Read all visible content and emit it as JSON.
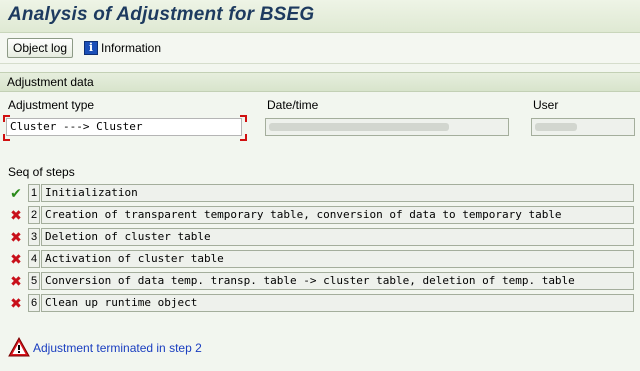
{
  "window": {
    "title": "Analysis of Adjustment for BSEG"
  },
  "toolbar": {
    "object_log_label": "Object log",
    "information_label": "Information"
  },
  "section": {
    "title": "Adjustment data"
  },
  "fields": {
    "adjustment_type": {
      "label": "Adjustment type",
      "value": "Cluster ---> Cluster"
    },
    "datetime": {
      "label": "Date/time",
      "value": ""
    },
    "user": {
      "label": "User",
      "value": ""
    }
  },
  "steps_label": "Seq of steps",
  "steps": [
    {
      "num": "1",
      "status": "success",
      "text": "Initialization"
    },
    {
      "num": "2",
      "status": "error",
      "text": "Creation of transparent temporary table, conversion of data to temporary table"
    },
    {
      "num": "3",
      "status": "error",
      "text": "Deletion of cluster table"
    },
    {
      "num": "4",
      "status": "error",
      "text": "Activation of cluster table"
    },
    {
      "num": "5",
      "status": "error",
      "text": "Conversion of data temp. transp. table -> cluster table, deletion of temp. table"
    },
    {
      "num": "6",
      "status": "error",
      "text": "Clean up runtime object"
    }
  ],
  "message": {
    "text": "Adjustment terminated in step 2"
  },
  "colors": {
    "success": "#2a8a1a",
    "error": "#c8101a",
    "message": "#1a3ec0",
    "title": "#1d3a5f"
  }
}
